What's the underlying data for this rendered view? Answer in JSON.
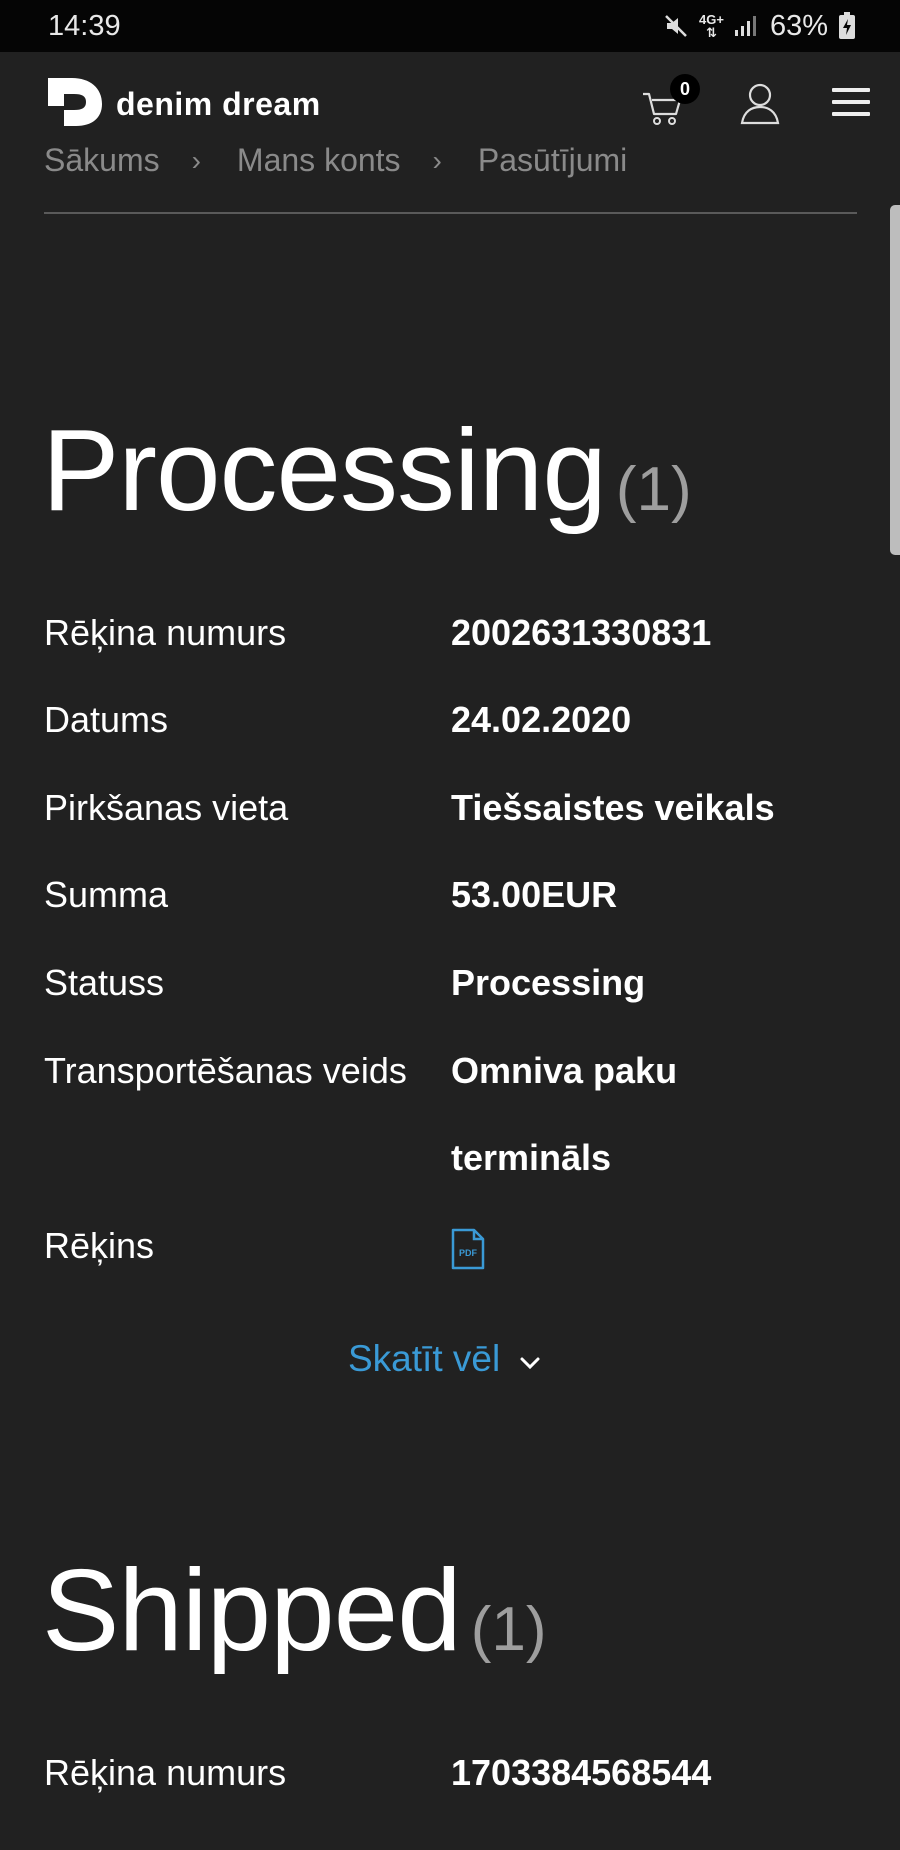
{
  "status_bar": {
    "time": "14:39",
    "network": "4G+",
    "battery": "63%",
    "icons": [
      "mute-icon",
      "network-4g-icon",
      "signal-icon",
      "battery-icon"
    ]
  },
  "header": {
    "brand": "denim dream",
    "cart_count": "0",
    "icons": [
      "logo-icon",
      "cart-icon",
      "user-icon",
      "menu-icon"
    ]
  },
  "breadcrumb": {
    "items": [
      "Sākums",
      "Mans konts",
      "Pasūtījumi"
    ],
    "separator": "›"
  },
  "sections": [
    {
      "title": "Processing",
      "count": "(1)",
      "rows": [
        {
          "label": "Rēķina numurs",
          "value": "2002631330831"
        },
        {
          "label": "Datums",
          "value": "24.02.2020"
        },
        {
          "label": "Pirkšanas vieta",
          "value": "Tiešsaistes veikals"
        },
        {
          "label": "Summa",
          "value": "53.00EUR"
        },
        {
          "label": "Statuss",
          "value": "Processing"
        },
        {
          "label": "Transportēšanas veids",
          "value": "Omniva paku",
          "value_line2": "termināls"
        },
        {
          "label": "Rēķins",
          "value_icon": "pdf-icon",
          "icon_text": "PDF"
        }
      ],
      "more_label": "Skatīt vēl"
    },
    {
      "title": "Shipped",
      "count": "(1)",
      "rows": [
        {
          "label": "Rēķina numurs",
          "value": "1703384568544"
        }
      ]
    }
  ],
  "colors": {
    "background": "#212121",
    "status_bar": "#050505",
    "link": "#3a9ad6",
    "muted": "#8a8a8a"
  }
}
